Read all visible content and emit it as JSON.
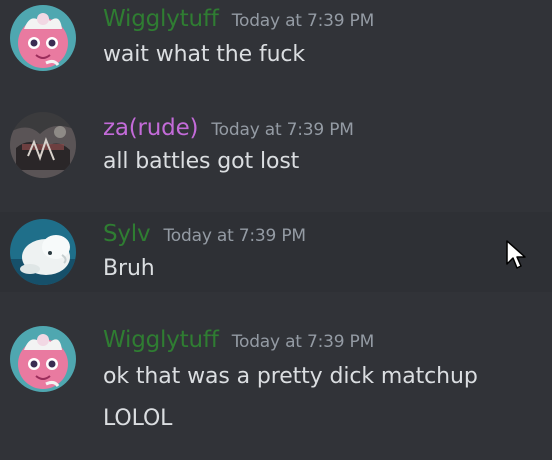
{
  "messages": [
    {
      "author": "Wigglytuff",
      "author_color": "#2f7d32",
      "avatar_icon": "pink-pokemon-avatar-icon",
      "timestamp": "Today at 7:39 PM",
      "lines": [
        "wait what the fuck"
      ]
    },
    {
      "author": "za(rude)",
      "author_color": "#c36bd9",
      "avatar_icon": "dark-artwork-avatar-icon",
      "timestamp": "Today at 7:39 PM",
      "lines": [
        "all battles got lost"
      ]
    },
    {
      "author": "Sylv",
      "author_color": "#2f7d32",
      "avatar_icon": "beluga-whale-avatar-icon",
      "timestamp": "Today at 7:39 PM",
      "lines": [
        "Bruh"
      ]
    },
    {
      "author": "Wigglytuff",
      "author_color": "#2f7d32",
      "avatar_icon": "pink-pokemon-avatar-icon",
      "timestamp": "Today at 7:39 PM",
      "lines": [
        "ok that was a pretty dick matchup",
        "LOLOL"
      ]
    }
  ],
  "pointer_icon": "mouse-pointer-icon"
}
